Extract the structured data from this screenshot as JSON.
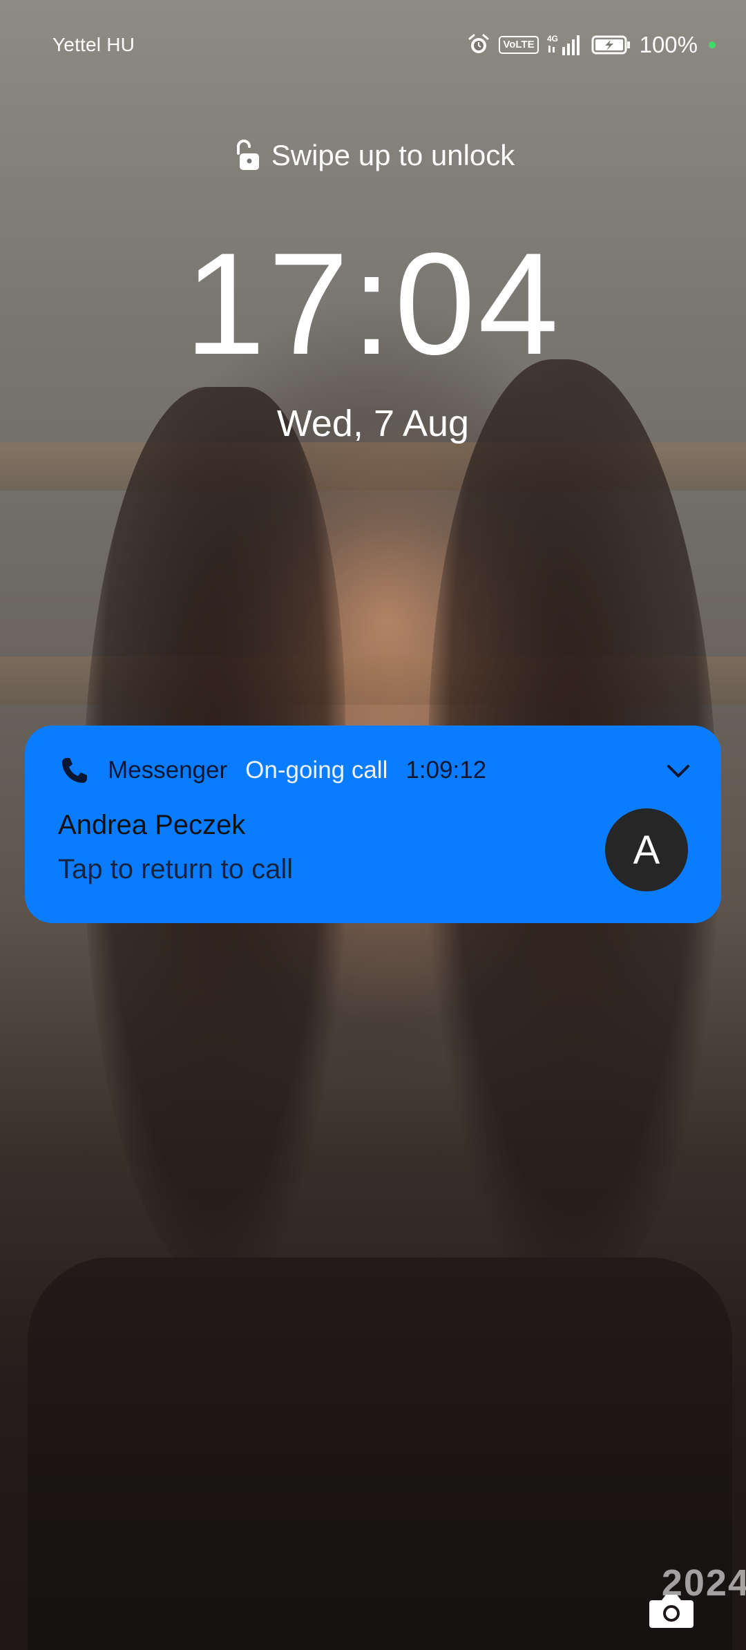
{
  "status_bar": {
    "carrier": "Yettel HU",
    "volte": "VoLTE",
    "network": "4G",
    "battery_percent": "100%",
    "icons": [
      "alarm-icon",
      "volte-icon",
      "signal-icon",
      "battery-charging-icon",
      "green-dot-indicator"
    ]
  },
  "lock_screen": {
    "unlock_hint": "Swipe up to unlock",
    "time": "17:04",
    "date": "Wed, 7 Aug"
  },
  "notification": {
    "app": "Messenger",
    "status": "On-going call",
    "timer": "1:09:12",
    "title": "Andrea Peczek",
    "text": "Tap to return to call",
    "avatar_letter": "A",
    "accent_color": "#0a7cff",
    "icons": [
      "phone-icon",
      "chevron-down-icon"
    ]
  },
  "bottom": {
    "watermark": "2024",
    "camera_icon": "camera-icon"
  }
}
